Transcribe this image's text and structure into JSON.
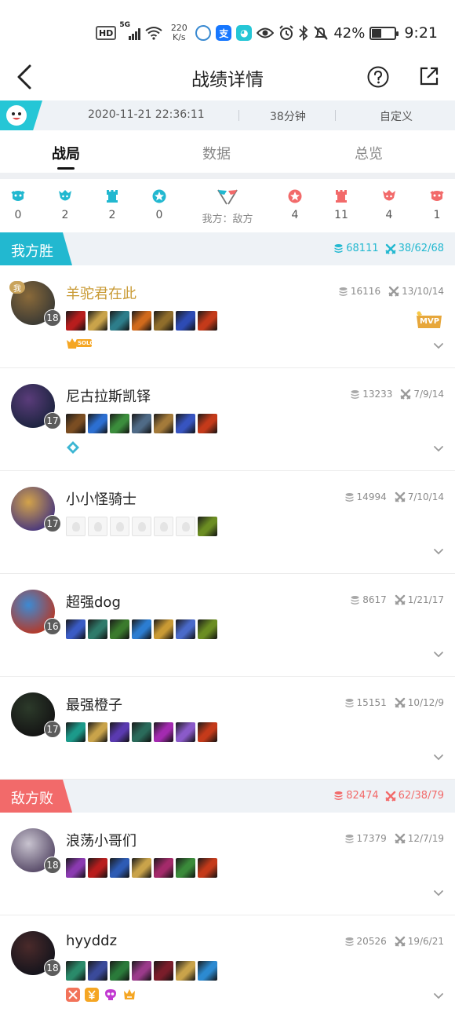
{
  "status_bar": {
    "hd": "HD",
    "net": "5G",
    "speed_value": "220",
    "speed_unit": "K/s",
    "battery": "42%",
    "battery_level": 0.42,
    "time": "9:21"
  },
  "nav": {
    "title": "战绩详情"
  },
  "info": {
    "datetime": "2020-11-21 22:36:11",
    "duration": "38分钟",
    "mode": "自定义"
  },
  "tabs": [
    {
      "label": "战局",
      "active": true
    },
    {
      "label": "数据",
      "active": false
    },
    {
      "label": "总览",
      "active": false
    }
  ],
  "objectives": {
    "ours": [
      {
        "icon": "baron-icon",
        "value": "0",
        "color": "#22b8d0"
      },
      {
        "icon": "dragon-icon",
        "value": "2",
        "color": "#22b8d0"
      },
      {
        "icon": "tower-icon",
        "value": "2",
        "color": "#22b8d0"
      },
      {
        "icon": "kill-star-icon",
        "value": "0",
        "color": "#22b8d0"
      }
    ],
    "vs_label": "我方：敌方",
    "theirs": [
      {
        "icon": "kill-star-icon",
        "value": "4",
        "color": "#f26a6a"
      },
      {
        "icon": "tower-icon",
        "value": "11",
        "color": "#f26a6a"
      },
      {
        "icon": "dragon-icon",
        "value": "4",
        "color": "#f26a6a"
      },
      {
        "icon": "baron-icon",
        "value": "1",
        "color": "#f26a6a"
      }
    ]
  },
  "teams": [
    {
      "label": "我方胜",
      "color": "#22b8d0",
      "gold": "68111",
      "kda": "38/62/68",
      "players": [
        {
          "name": "羊驼君在此",
          "name_gold": true,
          "is_me": true,
          "me_tag": "我",
          "level": "18",
          "gold": "16116",
          "kda": "13/10/14",
          "mvp": true,
          "mvp_label": "MVP",
          "solo": true,
          "solo_label": "SOLO",
          "avatar": [
            "#8a6a3a",
            "#3b3a34"
          ],
          "items": [
            "#b81d1d",
            "#c9a34a",
            "#2d7d8a",
            "#d06a1c",
            "#8f6d2b",
            "#2d4bb4",
            "#c43a1a"
          ],
          "tags": []
        },
        {
          "name": "尼古拉斯凯铎",
          "level": "17",
          "gold": "13233",
          "kda": "7/9/14",
          "avatar": [
            "#5a3c7a",
            "#1d2440"
          ],
          "items": [
            "#7a4d22",
            "#2c6fd1",
            "#3b8d3c",
            "#4f6a86",
            "#a37a3a",
            "#3754c0",
            "#c43a1a"
          ],
          "tags": [
            {
              "icon": "diamond-tag-icon",
              "color": "#3cb6d3"
            }
          ]
        },
        {
          "name": "小小怪骑士",
          "level": "17",
          "gold": "14994",
          "kda": "7/10/14",
          "avatar": [
            "#d3a34a",
            "#4c3a7c"
          ],
          "items": [
            "empty",
            "empty",
            "empty",
            "empty",
            "empty",
            "empty",
            "#6b8d22"
          ],
          "tags": []
        },
        {
          "name": "超强dog",
          "level": "16",
          "gold": "8617",
          "kda": "1/21/17",
          "avatar": [
            "#3d8ad3",
            "#b43a2a"
          ],
          "items": [
            "#3a5bc4",
            "#2f7a6a",
            "#3a7a2c",
            "#2c7dd1",
            "#c99a34",
            "#4a6ac9",
            "#6b8d22"
          ],
          "tags": []
        },
        {
          "name": "最强橙子",
          "level": "17",
          "gold": "15151",
          "kda": "10/12/9",
          "avatar": [
            "#2c3a2a",
            "#141414"
          ],
          "items": [
            "#1c9a8a",
            "#c9a34a",
            "#5a3ab0",
            "#2a6a5a",
            "#a32ab0",
            "#8a5ac9",
            "#c43a1a"
          ],
          "tags": []
        }
      ]
    },
    {
      "label": "敌方败",
      "color": "#f26a6a",
      "gold": "82474",
      "kda": "62/38/79",
      "players": [
        {
          "name": "浪荡小哥们",
          "level": "18",
          "gold": "17379",
          "kda": "12/7/19",
          "avatar": [
            "#c8c3cf",
            "#5a4d6a"
          ],
          "items": [
            "#8a3ab0",
            "#b81d1d",
            "#2d5bb4",
            "#c9a34a",
            "#a32a6a",
            "#3a8a3a",
            "#c43a1a"
          ],
          "tags": []
        },
        {
          "name": "hyyddz",
          "level": "18",
          "gold": "20526",
          "kda": "19/6/21",
          "avatar": [
            "#4a2a2a",
            "#14141c"
          ],
          "items": [
            "#2a8a6a",
            "#3a4a9a",
            "#2a7a3a",
            "#9a3a8a",
            "#7a1d2a",
            "#c9a34a",
            "#2c8ad1"
          ],
          "tags": [
            {
              "icon": "scissors-tag-icon",
              "color": "#f2735a"
            },
            {
              "icon": "yuan-tag-icon",
              "color": "#f5a623"
            },
            {
              "icon": "skull-tag-icon",
              "color": "#c23ad1"
            },
            {
              "icon": "crown-tag-icon",
              "color": "#f5a623"
            }
          ]
        }
      ]
    }
  ]
}
